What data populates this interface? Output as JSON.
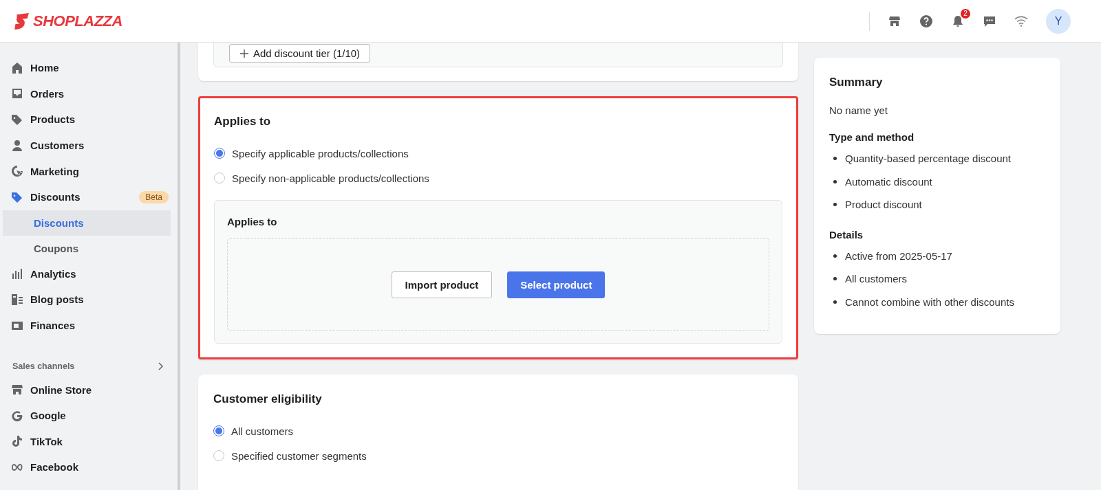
{
  "header": {
    "logo": "SHOPLAZZA",
    "notification_count": "2",
    "avatar": "Y"
  },
  "sidebar": {
    "items": [
      {
        "label": "Home",
        "selected": false
      },
      {
        "label": "Orders",
        "selected": false
      },
      {
        "label": "Products",
        "selected": false
      },
      {
        "label": "Customers",
        "selected": false
      },
      {
        "label": "Marketing",
        "selected": false
      },
      {
        "label": "Discounts",
        "selected": true,
        "badge": "Beta",
        "children": [
          {
            "label": "Discounts",
            "selected": true
          },
          {
            "label": "Coupons",
            "selected": false
          }
        ]
      },
      {
        "label": "Analytics",
        "selected": false
      },
      {
        "label": "Blog posts",
        "selected": false
      },
      {
        "label": "Finances",
        "selected": false
      }
    ],
    "sales_channels": {
      "title": "Sales channels",
      "items": [
        {
          "label": "Online Store",
          "selected": false
        },
        {
          "label": "Google",
          "selected": false
        },
        {
          "label": "TikTok",
          "selected": false
        },
        {
          "label": "Facebook",
          "selected": false
        }
      ]
    }
  },
  "tier_button": "Add discount tier (1/10)",
  "applies_to": {
    "title": "Applies to",
    "options": [
      {
        "label": "Specify applicable products/collections",
        "selected": true
      },
      {
        "label": "Specify non-applicable products/collections",
        "selected": false
      }
    ],
    "panel": {
      "title": "Applies to",
      "buttons": [
        {
          "label": "Import product",
          "kind": "secondary"
        },
        {
          "label": "Select product",
          "kind": "primary"
        }
      ]
    }
  },
  "customer_eligibility": {
    "title": "Customer eligibility",
    "options": [
      {
        "label": "All customers",
        "selected": true
      },
      {
        "label": "Specified customer segments",
        "selected": false
      }
    ]
  },
  "summary": {
    "title": "Summary",
    "name": "No name yet",
    "sections": [
      {
        "heading": "Type and method",
        "bullets": [
          "Quantity-based percentage discount",
          "Automatic discount",
          "Product discount"
        ]
      },
      {
        "heading": "Details",
        "bullets": [
          "Active from 2025-05-17",
          "All customers",
          "Cannot combine with other discounts"
        ]
      }
    ]
  }
}
